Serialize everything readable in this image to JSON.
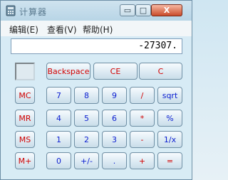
{
  "window": {
    "title": "计算器",
    "minimize_label": "▭",
    "maximize_label": "□",
    "close_label": "X"
  },
  "menu": {
    "file": "编辑(E)",
    "view": "查看(V)",
    "help": "帮助(H)"
  },
  "display": {
    "value": "-27307."
  },
  "buttons": {
    "backspace": "Backspace",
    "ce": "CE",
    "c": "C",
    "mc": "MC",
    "mr": "MR",
    "ms": "MS",
    "mplus": "M+",
    "7": "7",
    "8": "8",
    "9": "9",
    "4": "4",
    "5": "5",
    "6": "6",
    "1": "1",
    "2": "2",
    "3": "3",
    "0": "0",
    "plusminus": "+/-",
    "dot": ".",
    "divide": "/",
    "multiply": "*",
    "minus": "-",
    "plus": "+",
    "sqrt": "sqrt",
    "percent": "%",
    "reciprocal": "1/x",
    "equals": "="
  }
}
